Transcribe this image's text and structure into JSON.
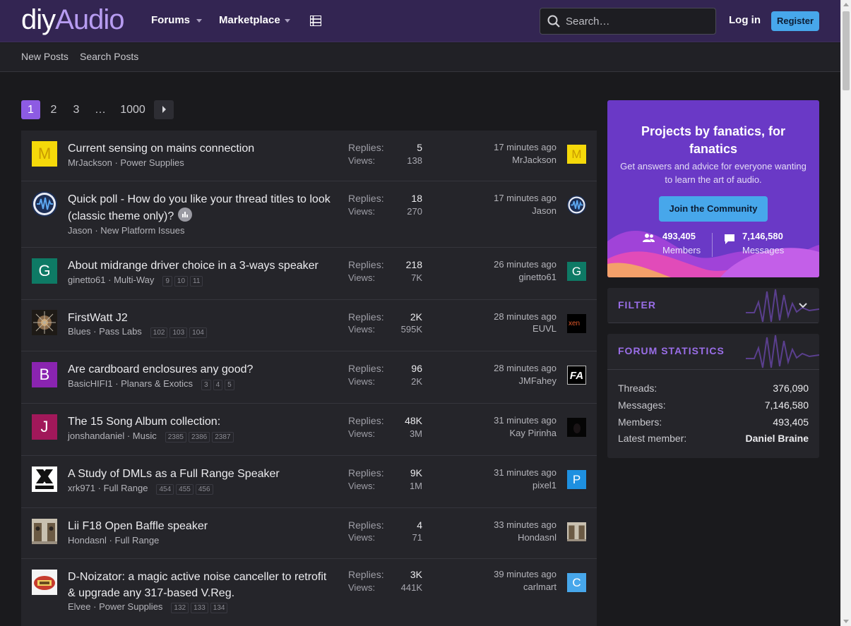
{
  "brand": {
    "logo_left": "diy",
    "logo_right": "Audio"
  },
  "nav": {
    "forums": "Forums",
    "marketplace": "Marketplace"
  },
  "search": {
    "placeholder": "Search…"
  },
  "account": {
    "login": "Log in",
    "register": "Register"
  },
  "subnav": {
    "new_posts": "New Posts",
    "search_posts": "Search Posts"
  },
  "pagination": {
    "pages": [
      "1",
      "2",
      "3",
      "…",
      "1000"
    ],
    "current": "1"
  },
  "threads": [
    {
      "title": "Current sensing on mains connection",
      "author": "MrJackson",
      "forum": "Power Supplies",
      "pages": [],
      "replies_label": "Replies:",
      "replies": "5",
      "views_label": "Views:",
      "views": "138",
      "time": "17 minutes ago",
      "last_poster": "MrJackson",
      "avatar_letter": "M",
      "avatar_color": "#f5d90a",
      "last_avatar_letter": "M"
    },
    {
      "title": "Quick poll - How do you like your thread titles to look (classic theme only)?",
      "author": "Jason",
      "forum": "New Platform Issues",
      "pages": [],
      "replies_label": "Replies:",
      "replies": "18",
      "views_label": "Views:",
      "views": "270",
      "time": "17 minutes ago",
      "last_poster": "Jason",
      "avatar_letter": "",
      "avatar_color": "#1c2e55",
      "last_avatar_letter": ""
    },
    {
      "title": "About midrange driver choice in a 3-ways speaker",
      "author": "ginetto61",
      "forum": "Multi-Way",
      "pages": [
        "9",
        "10",
        "11"
      ],
      "replies_label": "Replies:",
      "replies": "218",
      "views_label": "Views:",
      "views": "7K",
      "time": "26 minutes ago",
      "last_poster": "ginetto61",
      "avatar_letter": "G",
      "avatar_color": "#0e7a65",
      "last_avatar_letter": "G"
    },
    {
      "title": "FirstWatt J2",
      "author": "Blues",
      "forum": "Pass Labs",
      "pages": [
        "102",
        "103",
        "104"
      ],
      "replies_label": "Replies:",
      "replies": "2K",
      "views_label": "Views:",
      "views": "595K",
      "time": "28 minutes ago",
      "last_poster": "EUVL",
      "avatar_letter": "",
      "avatar_color": "#2a2420",
      "last_avatar_letter": "xen"
    },
    {
      "title": "Are cardboard enclosures any good?",
      "author": "BasicHIFI1",
      "forum": "Planars & Exotics",
      "pages": [
        "3",
        "4",
        "5"
      ],
      "replies_label": "Replies:",
      "replies": "96",
      "views_label": "Views:",
      "views": "2K",
      "time": "28 minutes ago",
      "last_poster": "JMFahey",
      "avatar_letter": "B",
      "avatar_color": "#8a24b0",
      "last_avatar_letter": "FA"
    },
    {
      "title": "The 15 Song Album collection:",
      "author": "jonshandaniel",
      "forum": "Music",
      "pages": [
        "2385",
        "2386",
        "2387"
      ],
      "replies_label": "Replies:",
      "replies": "48K",
      "views_label": "Views:",
      "views": "3M",
      "time": "31 minutes ago",
      "last_poster": "Kay Pirinha",
      "avatar_letter": "J",
      "avatar_color": "#a1185a",
      "last_avatar_letter": ""
    },
    {
      "title": "A Study of DMLs as a Full Range Speaker",
      "author": "xrk971",
      "forum": "Full Range",
      "pages": [
        "454",
        "455",
        "456"
      ],
      "replies_label": "Replies:",
      "replies": "9K",
      "views_label": "Views:",
      "views": "1M",
      "time": "31 minutes ago",
      "last_poster": "pixel1",
      "avatar_letter": "",
      "avatar_color": "#ffffff",
      "last_avatar_letter": "P"
    },
    {
      "title": "Lii F18 Open Baffle speaker",
      "author": "Hondasnl",
      "forum": "Full Range",
      "pages": [],
      "replies_label": "Replies:",
      "replies": "4",
      "views_label": "Views:",
      "views": "71",
      "time": "33 minutes ago",
      "last_poster": "Hondasnl",
      "avatar_letter": "",
      "avatar_color": "#8a7a66",
      "last_avatar_letter": ""
    },
    {
      "title": "D-Noizator: a magic active noise canceller to retrofit & upgrade any 317-based V.Reg.",
      "author": "Elvee",
      "forum": "Power Supplies",
      "pages": [
        "132",
        "133",
        "134"
      ],
      "replies_label": "Replies:",
      "replies": "3K",
      "views_label": "Views:",
      "views": "441K",
      "time": "39 minutes ago",
      "last_poster": "carlmart",
      "avatar_letter": "",
      "avatar_color": "#f4f4f4",
      "last_avatar_letter": "C"
    }
  ],
  "promo": {
    "title": "Projects by fanatics, for fanatics",
    "text": "Get answers and advice for everyone wanting to learn the art of audio.",
    "button": "Join the Community",
    "members_count": "493,405",
    "members_label": "Members",
    "messages_count": "7,146,580",
    "messages_label": "Messages"
  },
  "filter": {
    "title": "FILTER"
  },
  "stats": {
    "title": "FORUM STATISTICS",
    "rows": [
      {
        "label": "Threads:",
        "value": "376,090"
      },
      {
        "label": "Messages:",
        "value": "7,146,580"
      },
      {
        "label": "Members:",
        "value": "493,405"
      },
      {
        "label": "Latest member:",
        "value": "Daniel Braine"
      }
    ]
  },
  "colors": {
    "header_bg": "#332552",
    "accent": "#8d5be3",
    "register_button": "#47a7eb",
    "promo_bg": "#6a39c6"
  }
}
